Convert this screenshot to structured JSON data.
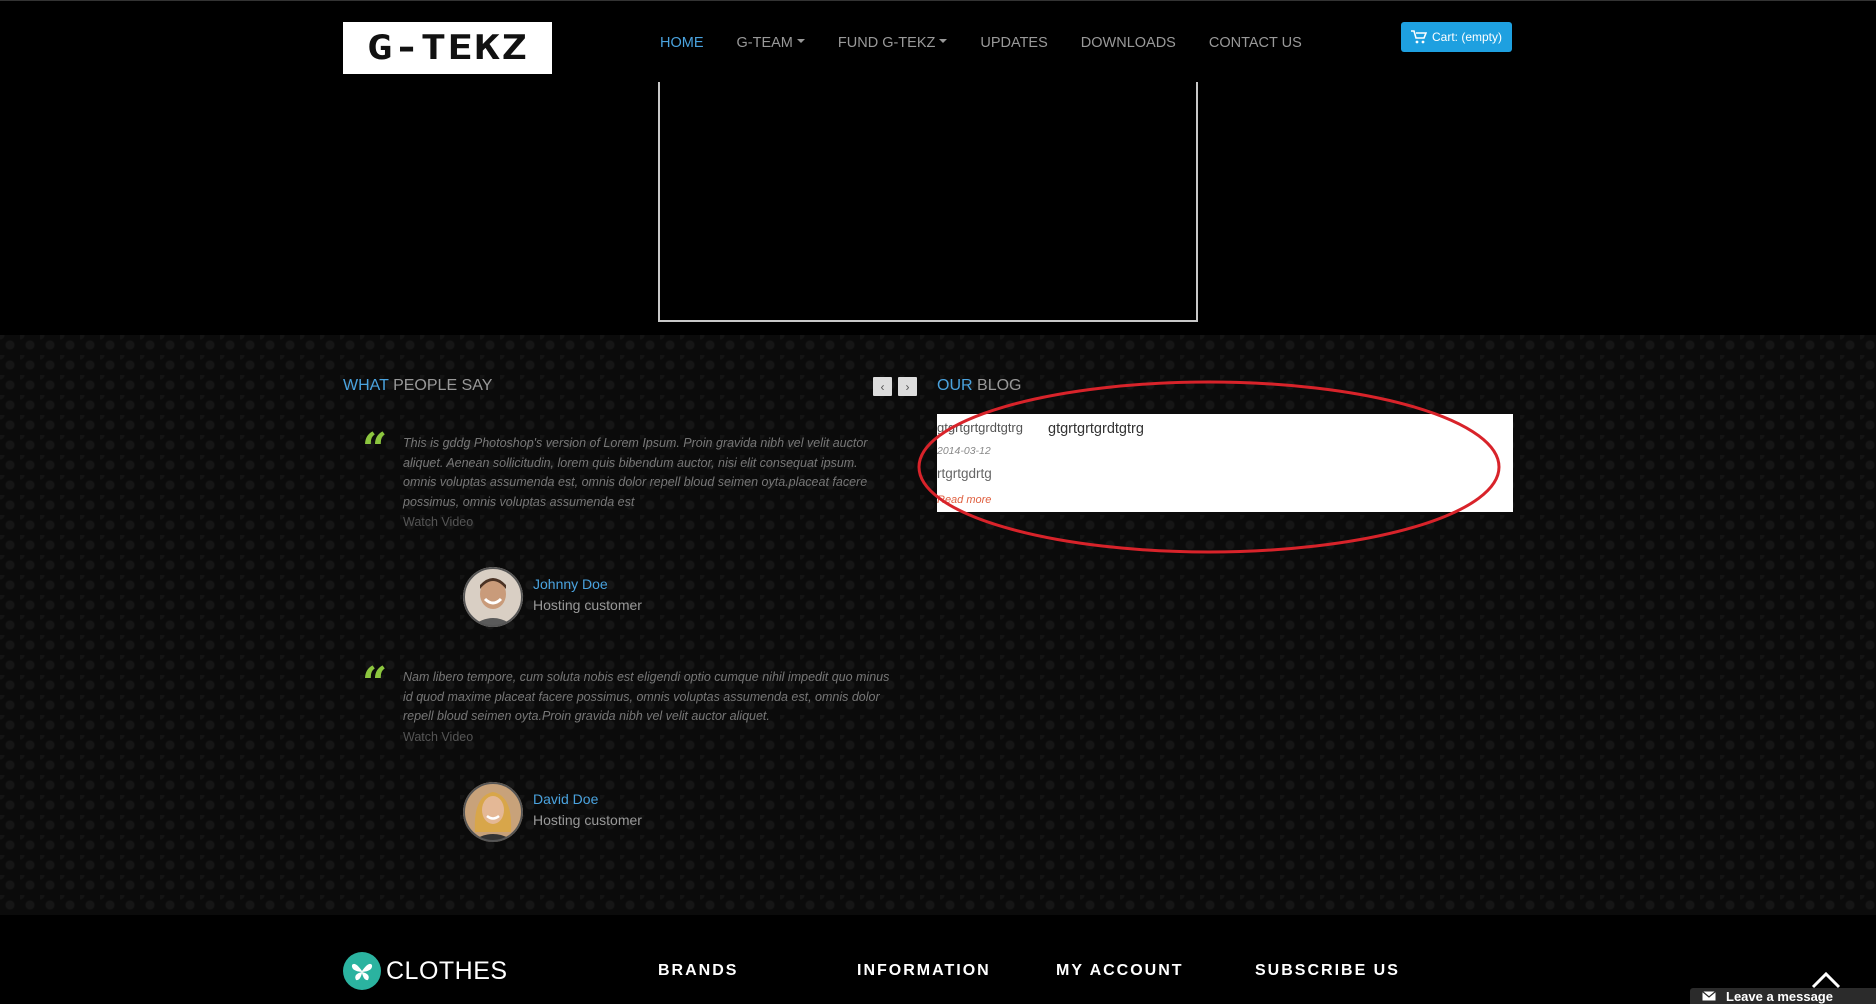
{
  "header": {
    "logo_text": "G-TEKZ",
    "nav": [
      {
        "label": "HOME",
        "active": true,
        "dropdown": false
      },
      {
        "label": "G-TEAM",
        "active": false,
        "dropdown": true
      },
      {
        "label": "FUND G-TEKZ",
        "active": false,
        "dropdown": true
      },
      {
        "label": "UPDATES",
        "active": false,
        "dropdown": false
      },
      {
        "label": "DOWNLOADS",
        "active": false,
        "dropdown": false
      },
      {
        "label": "CONTACT US",
        "active": false,
        "dropdown": false
      }
    ],
    "cart_label": "Cart: (empty)"
  },
  "testimonials": {
    "title_accent": "WHAT",
    "title_rest": "PEOPLE SAY",
    "prev_label": "‹",
    "next_label": "›",
    "items": [
      {
        "quote": "This is gddg Photoshop's version of Lorem Ipsum. Proin gravida nibh vel velit auctor aliquet. Aenean sollicitudin, lorem quis bibendum auctor, nisi elit consequat ipsum. omnis voluptas assumenda est, omnis dolor repell bloud seimen oyta.placeat facere possimus, omnis voluptas assumenda est",
        "watch_label": "Watch Video",
        "name": "Johnny Doe",
        "role": "Hosting customer"
      },
      {
        "quote": "Nam libero tempore, cum soluta nobis est eligendi optio cumque nihil impedit quo minus id quod maxime placeat facere possimus, omnis voluptas assumenda est, omnis dolor repell bloud seimen oyta.Proin gravida nibh vel velit auctor aliquet.",
        "watch_label": "Watch Video",
        "name": "David Doe",
        "role": "Hosting customer"
      }
    ]
  },
  "blog": {
    "title_accent": "OUR",
    "title_rest": "BLOG",
    "post": {
      "side_text": "gtgrtgrtgrdtgtrg",
      "title": "gtgrtgrtgrdtgtrg",
      "date": "2014-03-12",
      "excerpt": "rtgrtgdrtg",
      "read_more": "Read more"
    }
  },
  "footer": {
    "logo_text": "CLOTHES",
    "columns": [
      "BRANDS",
      "INFORMATION",
      "MY ACCOUNT",
      "SUBSCRIBE US"
    ],
    "leave_message": "Leave a message"
  },
  "colors": {
    "accent_blue": "#4aa3df",
    "quote_green": "#8cc63f",
    "cart_blue": "#1ea0e0",
    "annotation_red": "#d8232a"
  }
}
